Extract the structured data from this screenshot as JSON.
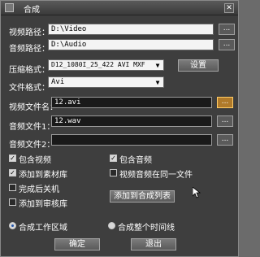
{
  "window": {
    "title": "合成",
    "close_glyph": "✕"
  },
  "video_path": {
    "label": "视频路径：",
    "value": "D:\\Video",
    "browse": "..."
  },
  "audio_path": {
    "label": "音频路径：",
    "value": "D:\\Audio",
    "browse": "..."
  },
  "compress_format": {
    "label": "压缩格式：",
    "value": "D12_1080I_25_422 AVI MXF",
    "settings_button": "设置"
  },
  "file_format": {
    "label": "文件格式：",
    "value": "Avi"
  },
  "video_file": {
    "label": "视频文件名：",
    "value": "12.avi",
    "browse": "..."
  },
  "audio_file1": {
    "label": "音频文件1：",
    "value": "12.wav",
    "browse": "..."
  },
  "audio_file2": {
    "label": "音频文件2：",
    "value": "",
    "browse": "..."
  },
  "options": {
    "include_video": {
      "label": "包含视频",
      "checked": true
    },
    "include_audio": {
      "label": "包含音频",
      "checked": true
    },
    "add_to_library": {
      "label": "添加到素材库",
      "checked": true
    },
    "same_file": {
      "label": "视频音频在同一文件",
      "checked": false
    },
    "shutdown": {
      "label": "完成后关机",
      "checked": false
    },
    "add_to_review": {
      "label": "添加到审核库",
      "checked": false
    }
  },
  "add_to_list_button": "添加到合成列表",
  "range": {
    "work_area": {
      "label": "合成工作区域",
      "selected": true
    },
    "timeline": {
      "label": "合成整个时间线",
      "selected": false
    }
  },
  "ok_button": "确定",
  "exit_button": "退出"
}
